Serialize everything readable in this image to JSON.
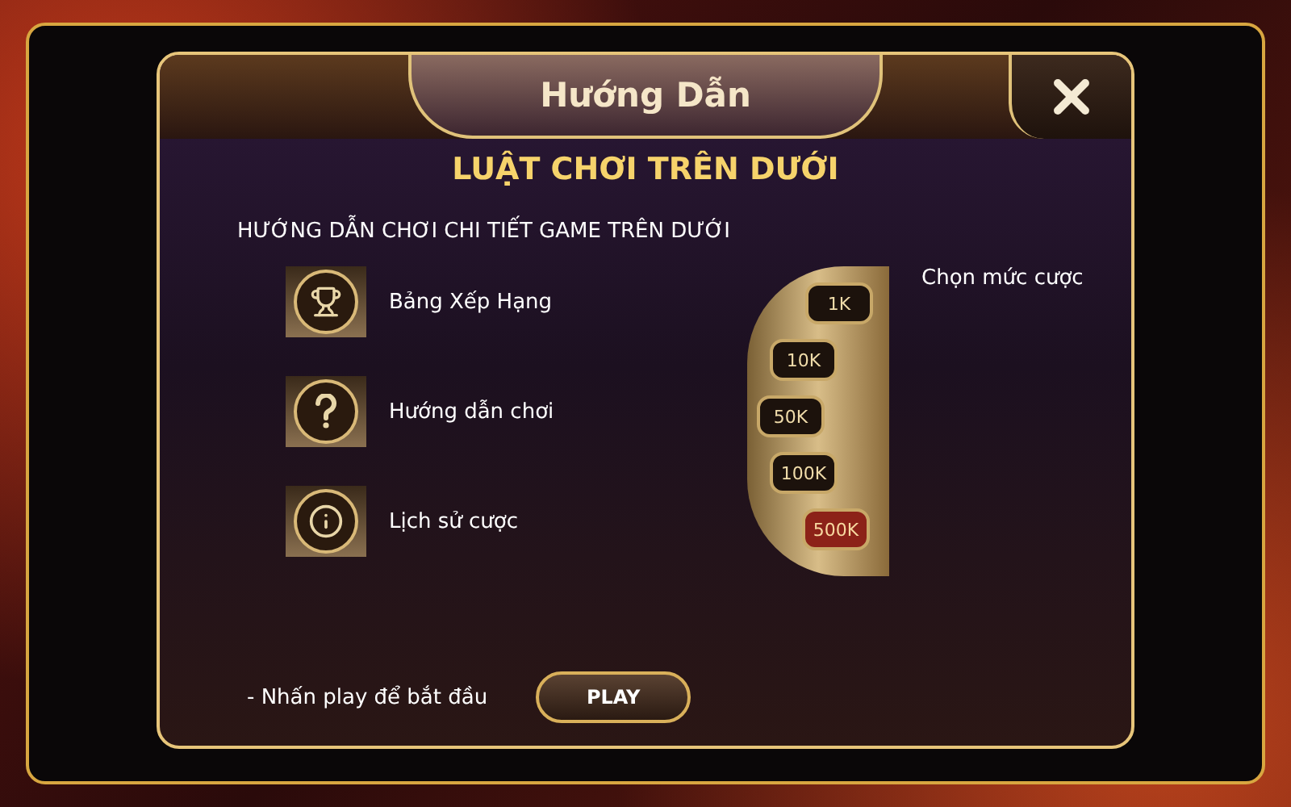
{
  "dialog": {
    "title": "Hướng Dẫn",
    "subtitle": "LUẬT CHƠI TRÊN DƯỚI",
    "intro": "HƯỚNG DẪN CHƠI CHI TIẾT GAME TRÊN DƯỚI"
  },
  "features": [
    {
      "kind": "trophy",
      "label": "Bảng Xếp Hạng"
    },
    {
      "kind": "help",
      "label": "Hướng dẫn chơi"
    },
    {
      "kind": "info",
      "label": "Lịch sử cược"
    }
  ],
  "bet": {
    "label": "Chọn mức cược",
    "chips": [
      {
        "label": "1K",
        "selected": false
      },
      {
        "label": "10K",
        "selected": false
      },
      {
        "label": "50K",
        "selected": false
      },
      {
        "label": "100K",
        "selected": false
      },
      {
        "label": "500K",
        "selected": true
      }
    ]
  },
  "footer": {
    "hint": "- Nhấn play để bắt đầu",
    "button": "PLAY"
  }
}
